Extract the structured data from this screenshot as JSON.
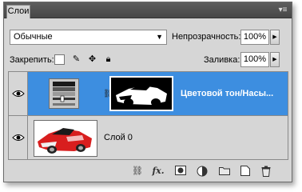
{
  "panel": {
    "tab_title": "Слои",
    "menu_glyph": "▾≡"
  },
  "blend_mode": {
    "value": "Обычные"
  },
  "opacity": {
    "label": "Непрозрачность:",
    "value": "100%"
  },
  "lock": {
    "label": "Закрепить:"
  },
  "fill": {
    "label": "Заливка:",
    "value": "100%"
  },
  "layers": [
    {
      "name": "Цветовой тон/Насы...",
      "selected": true
    },
    {
      "name": "Слой 0",
      "selected": false
    }
  ],
  "bottom_icons": [
    "link-icon",
    "fx-icon",
    "mask-icon",
    "adjustment-icon",
    "group-icon",
    "new-layer-icon",
    "trash-icon"
  ],
  "bottom_labels": {
    "fx": "fx."
  },
  "colors": {
    "selection": "#3d8ee0",
    "panel_bg": "#d6d6d6",
    "titlebar": "#4f4f4f"
  }
}
